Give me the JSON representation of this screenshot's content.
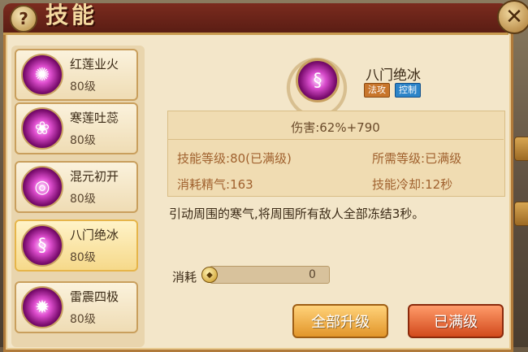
{
  "header": {
    "title": "技能",
    "help_label": "?",
    "close_label": "✕"
  },
  "skills": [
    {
      "name": "红莲业火",
      "level": "80级"
    },
    {
      "name": "寒莲吐蕊",
      "level": "80级"
    },
    {
      "name": "混元初开",
      "level": "80级"
    },
    {
      "name": "八门绝冰",
      "level": "80级"
    },
    {
      "name": "雷震四极",
      "level": "80级"
    }
  ],
  "selected": {
    "name": "八门绝冰",
    "tags": [
      "法攻",
      "控制"
    ],
    "damage": "伤害:62%+790",
    "skill_level_label": "技能等级:",
    "skill_level_value": "80(已满级)",
    "required_level_label": "所需等级:",
    "required_level_value": "已满级",
    "energy_label": "消耗精气:",
    "energy_value": "163",
    "cooldown_label": "技能冷却:",
    "cooldown_value": "12秒",
    "description": "引动周围的寒气,将周围所有敌人全部冻结3秒。"
  },
  "cost": {
    "label": "消耗",
    "value": "0"
  },
  "buttons": {
    "upgrade_all": "全部升级",
    "maxed": "已满级"
  },
  "colors": {
    "panel_bg": "#f3e6c9",
    "title_bar": "#7b2b1e",
    "accent_orange": "#e2962a",
    "accent_red": "#d24a1c",
    "tag_attack": "#c8762c",
    "tag_control": "#2c84c8"
  },
  "icons": {
    "skill_icon": "spirit-orb-icon",
    "coin": "coin-icon"
  }
}
